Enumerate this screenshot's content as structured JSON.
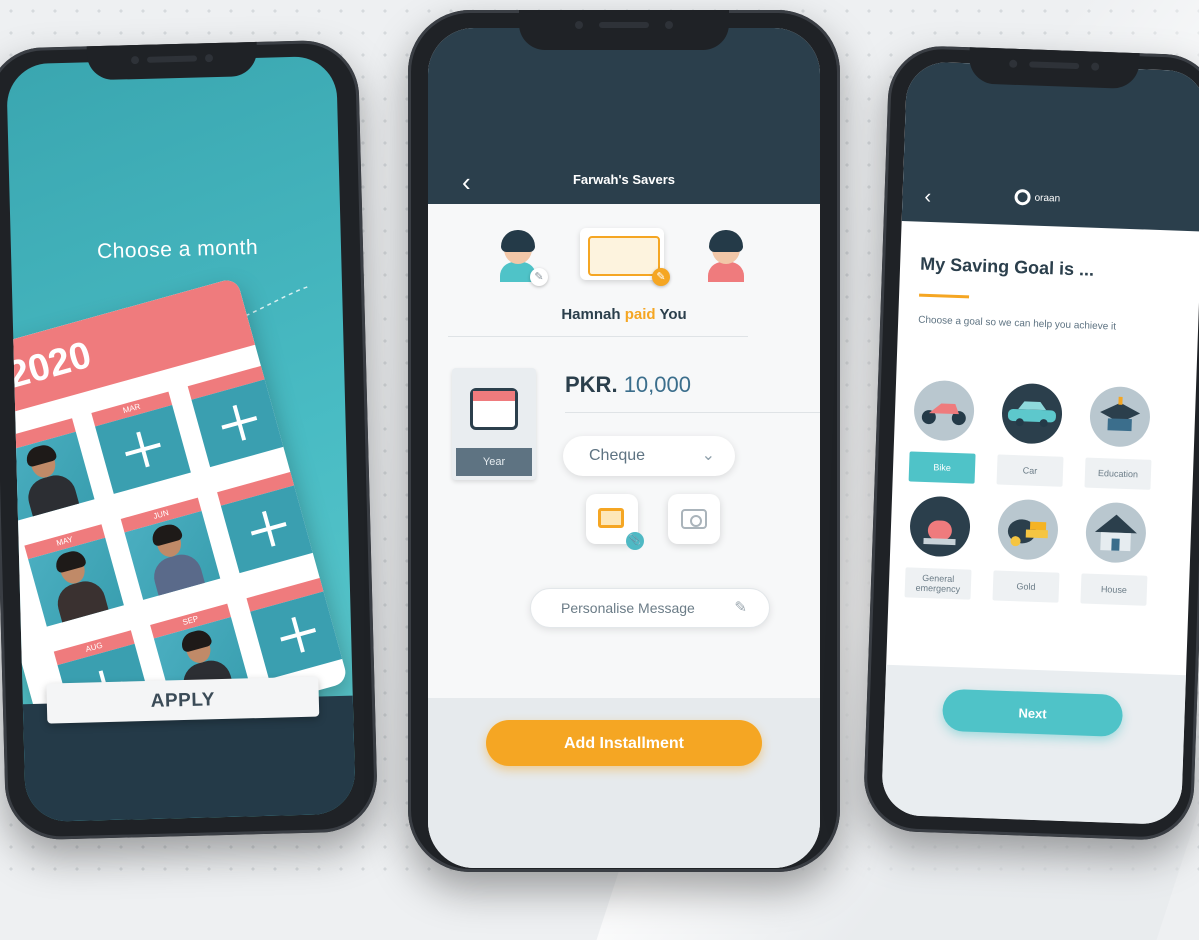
{
  "screen1": {
    "title": "Choose a month",
    "year": "2020",
    "months": [
      "",
      "MAR",
      "",
      "MAY",
      "JUN",
      "",
      "AUG",
      "SEP",
      ""
    ],
    "apply_label": "APPLY"
  },
  "screen2": {
    "header_title": "Farwah's Savers",
    "paid_line": {
      "payer": "Hamnah",
      "verb": "paid",
      "payee": "You"
    },
    "year_label": "Year",
    "amount": {
      "currency": "PKR.",
      "value": "10,000"
    },
    "payment_method": "Cheque",
    "message_placeholder": "Personalise Message",
    "add_button": "Add Installment"
  },
  "screen3": {
    "brand": "oraan",
    "title": "My Saving Goal is ...",
    "subtitle": "Choose a goal so we can help you achieve it",
    "goals": [
      {
        "label": "Bike",
        "selected": true
      },
      {
        "label": "Car",
        "selected": false
      },
      {
        "label": "Education",
        "selected": false
      },
      {
        "label": "General emergency",
        "selected": false
      },
      {
        "label": "Gold",
        "selected": false
      },
      {
        "label": "House",
        "selected": false
      }
    ],
    "next_label": "Next"
  },
  "colors": {
    "navy": "#2b3f4c",
    "teal": "#4fc3c8",
    "orange": "#f5a623",
    "coral": "#ef7b7d"
  }
}
